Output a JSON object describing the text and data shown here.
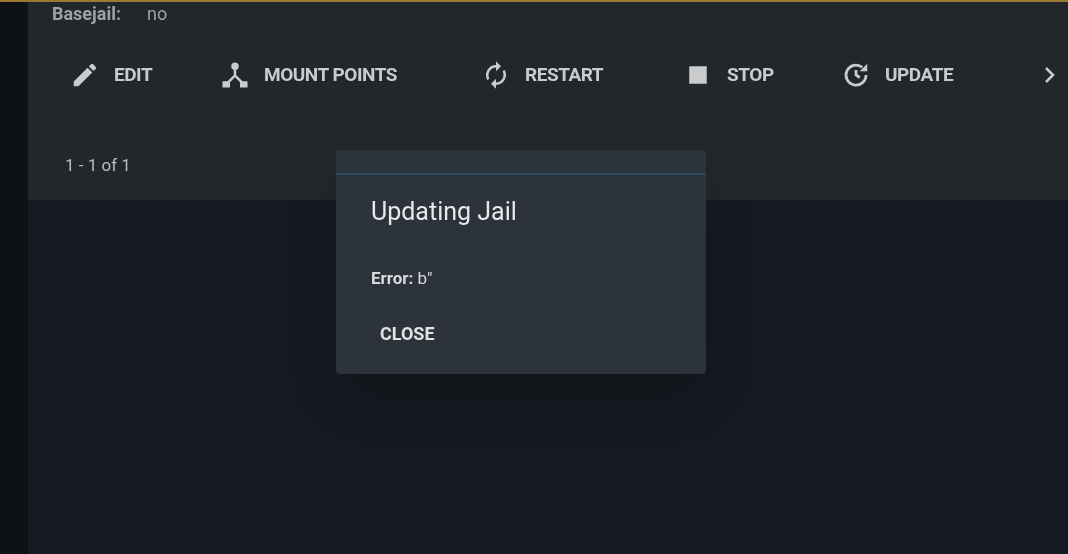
{
  "details": [
    {
      "label": "Basejail:",
      "value": "no"
    }
  ],
  "actions": [
    {
      "kind": "edit",
      "label": "EDIT"
    },
    {
      "kind": "mount",
      "label": "MOUNT POINTS"
    },
    {
      "kind": "restart",
      "label": "RESTART"
    },
    {
      "kind": "stop",
      "label": "STOP"
    },
    {
      "kind": "update",
      "label": "UPDATE"
    }
  ],
  "pagination": "1 - 1 of 1",
  "dialog": {
    "title": "Updating Jail",
    "message": "**Error:** b\"",
    "buttons": [
      "CLOSE"
    ]
  }
}
